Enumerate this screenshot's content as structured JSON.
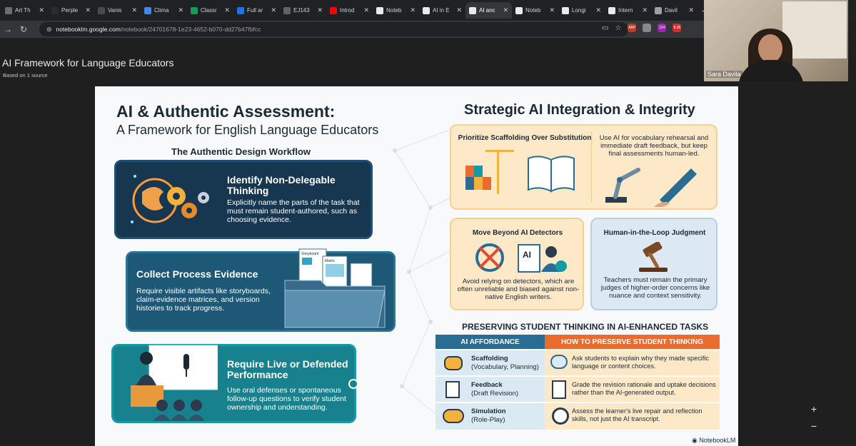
{
  "tabs": [
    {
      "label": "Art Th",
      "color": "#6d6d6d"
    },
    {
      "label": "Perple",
      "color": "#2b2b2b"
    },
    {
      "label": "Vanis",
      "color": "#4a4a4a"
    },
    {
      "label": "Clima",
      "color": "#4285f4"
    },
    {
      "label": "Classr",
      "color": "#0f9d58"
    },
    {
      "label": "Full ar",
      "color": "#1a73e8"
    },
    {
      "label": "EJ143",
      "color": "#5f6368"
    },
    {
      "label": "Introd",
      "color": "#ff0000"
    },
    {
      "label": "Noteb",
      "color": "#e8eaed"
    },
    {
      "label": "AI in E",
      "color": "#e8eaed"
    },
    {
      "label": "AI anc",
      "color": "#e8eaed",
      "active": true
    },
    {
      "label": "Noteb",
      "color": "#e8eaed"
    },
    {
      "label": "Longi",
      "color": "#e8eaed"
    },
    {
      "label": "Intern",
      "color": "#e8eaed"
    },
    {
      "label": "Davil",
      "color": "#9aa0a6"
    }
  ],
  "toolbar": {
    "url_host": "notebooklm.google.com",
    "url_path": "/notebook/24701678-1e23-4652-b070-dd27b47fbfcc",
    "ext_badges": [
      "ABP",
      "224",
      "8.36"
    ]
  },
  "page": {
    "title": "AI Framework for Language Educators",
    "subtitle": "Based on 1 source"
  },
  "webcam": {
    "name": "Sara Davila"
  },
  "slide": {
    "title_main": "AI & Authentic Assessment:",
    "title_sub": "A Framework for English Language Educators",
    "workflow_title": "The Authentic Design Workflow",
    "card1": {
      "title": "Identify Non-Delegable Thinking",
      "body": "Explicitly name the parts of the task that must remain student-authored, such as choosing evidence."
    },
    "card2": {
      "title": "Collect Process Evidence",
      "body": "Require visible artifacts like storyboards, claim-evidence matrices, and version histories to track progress.",
      "doc_labels": [
        "Storyboard",
        "Matrix"
      ]
    },
    "card3": {
      "title": "Require Live or Defended Performance",
      "body": "Use oral defenses or spontaneous follow-up questions to verify student ownership and understanding."
    },
    "right_title": "Strategic AI Integration & Integrity",
    "box1": {
      "title": "Prioritize Scaffolding Over Substitution",
      "body": "Use AI for vocabulary rehearsal and immediate draft feedback, but keep final assessments human-led."
    },
    "box2": {
      "title": "Move Beyond AI Detectors",
      "ai_label": "AI",
      "body": "Avoid relying on detectors, which are often unreliable and biased against non-native English writers."
    },
    "box3": {
      "title": "Human-in-the-Loop Judgment",
      "body": "Teachers must remain the primary judges of higher-order concerns like nuance and context sensitivity."
    },
    "table_title": "PRESERVING STUDENT THINKING IN AI-ENHANCED TASKS",
    "table_headers": [
      "AI AFFORDANCE",
      "HOW TO PRESERVE STUDENT THINKING"
    ],
    "rows": [
      {
        "name": "Scaffolding",
        "sub": "(Vocabulary, Planning)",
        "desc": "Ask students to explain why they made specific language or content choices."
      },
      {
        "name": "Feedback",
        "sub": "(Draft Revision)",
        "desc": "Grade the revision rationale and uptake decisions rather than the AI-generated output."
      },
      {
        "name": "Simulation",
        "sub": "(Role-Play)",
        "desc": "Assess the learner's live repair and reflection skills, not just the AI transcript."
      }
    ],
    "brand": "NotebookLM"
  },
  "zoom": {
    "in": "+",
    "out": "−"
  }
}
